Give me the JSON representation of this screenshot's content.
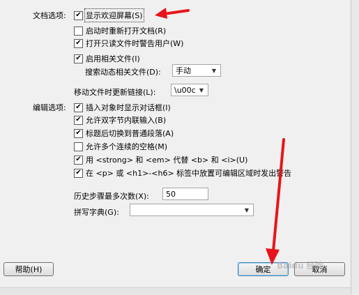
{
  "doc_options": {
    "heading": "文档选项:",
    "show_welcome": {
      "label": "显示欢迎屏幕(S)",
      "checked": true
    },
    "reopen_docs": {
      "label": "启动时重新打开文档(R)",
      "checked": false
    },
    "warn_readonly": {
      "label": "打开只读文件时警告用户(W)",
      "checked": true
    },
    "enable_related": {
      "label": "启用相关文件(I)",
      "checked": true
    },
    "search_dynamic_label": "搜索动态相关文件(D):",
    "search_dynamic_value": "手动",
    "update_links_label": "移动文件时更新链接(L):",
    "update_links_value": "\\u00c"
  },
  "edit_options": {
    "heading": "编辑选项:",
    "insert_dialog": {
      "label": "插入对象时显示对话框(I)",
      "checked": true
    },
    "dbcs_inline": {
      "label": "允许双字节内联输入(B)",
      "checked": true
    },
    "heading_switch": {
      "label": "标题后切换到普通段落(A)",
      "checked": true
    },
    "multiple_spaces": {
      "label": "允许多个连续的空格(M)",
      "checked": false
    },
    "strong_em": {
      "label": "用 <strong> 和 <em> 代替 <b> 和 <i>(U)",
      "checked": true
    },
    "warn_editable": {
      "label": "在 <p> 或 <h1>-<h6> 标签中放置可编辑区域时发出警告",
      "checked": true
    }
  },
  "history_label": "历史步骤最多次数(X):",
  "history_value": "50",
  "spell_label": "拼写字典(G):",
  "spell_value": "",
  "buttons": {
    "help": "帮助(H)",
    "ok": "确定",
    "cancel": "取消"
  },
  "watermark": "Baidu 经验",
  "icons": {
    "check": "check-icon",
    "dropdown": "chevron-down-icon"
  },
  "colors": {
    "annotation_arrow": "#e8141b",
    "focus_border": "#3c7fb1"
  }
}
